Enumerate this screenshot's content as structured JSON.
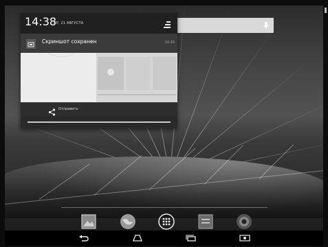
{
  "status_bar": {
    "time": "14:38",
    "date": "СР, 21 АВГУСТА"
  },
  "notification": {
    "title": "Скриншот сохранен",
    "time": "14:29",
    "action_label": "Отправить"
  },
  "icons": {
    "settings": "settings-toggle-icon",
    "notification": "screenshot-icon",
    "share": "share-icon",
    "mic": "mic-icon",
    "dock": [
      "gallery-icon",
      "browser-icon",
      "apps-icon",
      "settings-app-icon",
      "camera-icon"
    ],
    "nav": [
      "back-icon",
      "home-icon",
      "recent-apps-icon",
      "screenshot-nav-icon"
    ]
  },
  "colors": {
    "shade": "#2a2a2a",
    "notification_bg": "#3b3b3b",
    "accent_text": "#ffffff"
  }
}
